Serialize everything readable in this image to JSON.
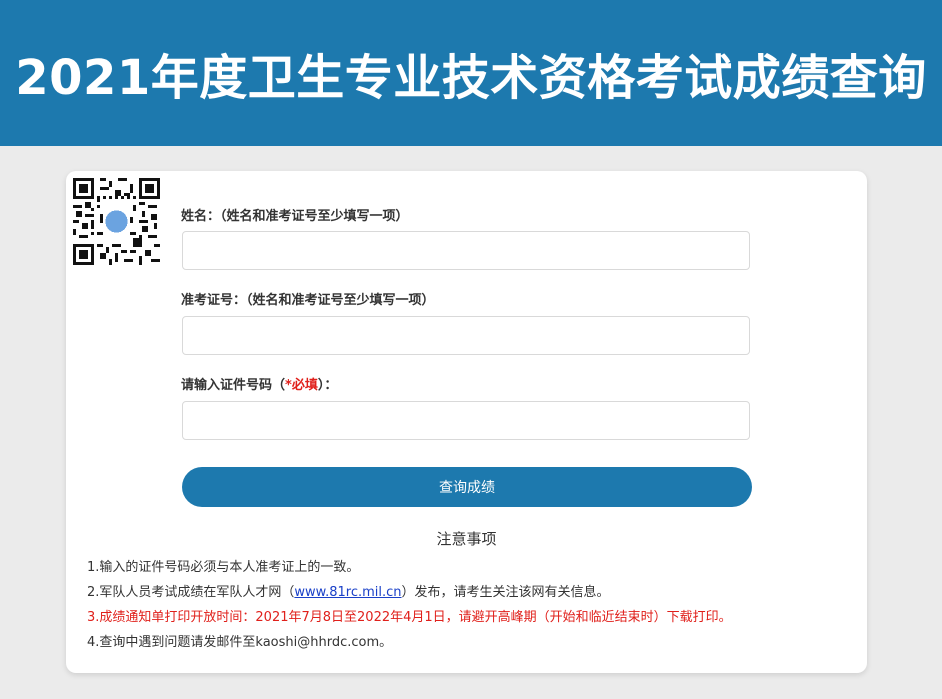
{
  "header": {
    "title": "2021年度卫生专业技术资格考试成绩查询"
  },
  "form": {
    "name_label": "姓名：（姓名和准考证号至少填写一项）",
    "name_value": "",
    "ticket_label": "准考证号：（姓名和准考证号至少填写一项）",
    "ticket_value": "",
    "id_label_prefix": "请输入证件号码（",
    "id_label_required": "*必填",
    "id_label_suffix": "）：",
    "id_value": "",
    "submit_label": "查询成绩"
  },
  "notice": {
    "title": "注意事项",
    "item1": "1.输入的证件号码必须与本人准考证上的一致。",
    "item2_prefix": "2.军队人员考试成绩在军队人才网（",
    "item2_link": "www.81rc.mil.cn",
    "item2_suffix": "）发布，请考生关注该网有关信息。",
    "item3": "3.成绩通知单打印开放时间：2021年7月8日至2022年4月1日，请避开高峰期（开始和临近结束时）下载打印。",
    "item4": "4.查询中遇到问题请发邮件至kaoshi@hhrdc.com。"
  },
  "colors": {
    "brand": "#1d79ae",
    "required": "#e0201b",
    "link": "#1a40c8",
    "background": "#ebebeb"
  }
}
